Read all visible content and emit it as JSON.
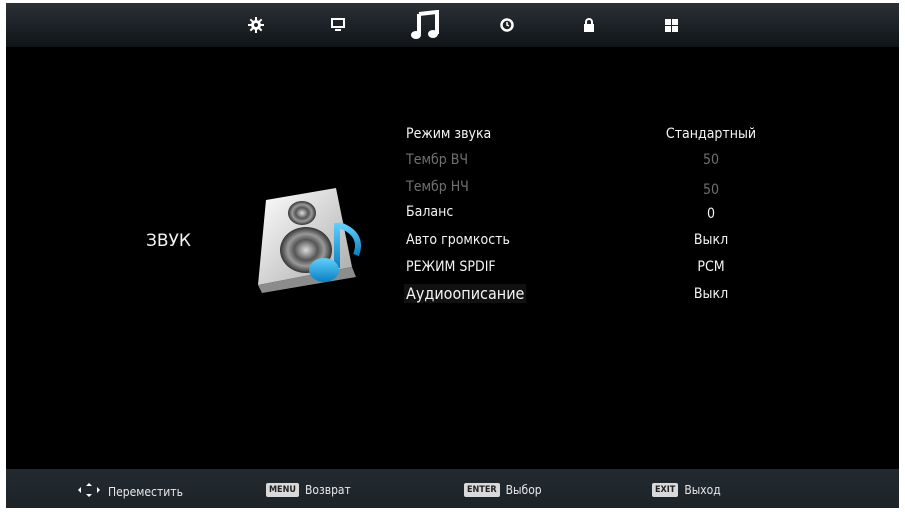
{
  "top_tabs": [
    {
      "name": "picture-settings",
      "icon": "gear-icon"
    },
    {
      "name": "screen",
      "icon": "monitor-icon"
    },
    {
      "name": "sound",
      "icon": "music-note-icon",
      "selected": true
    },
    {
      "name": "time",
      "icon": "clock-icon"
    },
    {
      "name": "lock",
      "icon": "lock-icon"
    },
    {
      "name": "setup",
      "icon": "grid-icon"
    }
  ],
  "page_title": "ЗВУК",
  "menu": [
    {
      "label": "Режим звука",
      "value": "Стандартный",
      "enabled": true
    },
    {
      "label": "Тембр ВЧ",
      "value": "50",
      "enabled": false
    },
    {
      "label": "Тембр НЧ",
      "value": "50",
      "enabled": false
    },
    {
      "label": "Баланс",
      "value": "0",
      "enabled": true
    },
    {
      "label": "Авто громкость",
      "value": "Выкл",
      "enabled": true
    },
    {
      "label": "РЕЖИМ SPDIF",
      "value": "PCM",
      "enabled": true
    },
    {
      "label": "Аудиоописание",
      "value": "Выкл",
      "enabled": true,
      "selected": true
    }
  ],
  "hints": {
    "move": {
      "label": "Переместить",
      "icon": "dpad-arrows-icon"
    },
    "back": {
      "key": "MENU",
      "label": "Возврат"
    },
    "select": {
      "key": "ENTER",
      "label": "Выбор"
    },
    "exit": {
      "key": "EXIT",
      "label": "Выход"
    }
  },
  "colors": {
    "accent": "#2aa7e0",
    "background": "#000000",
    "text": "#f4f4f4",
    "disabled_text": "#707070"
  }
}
